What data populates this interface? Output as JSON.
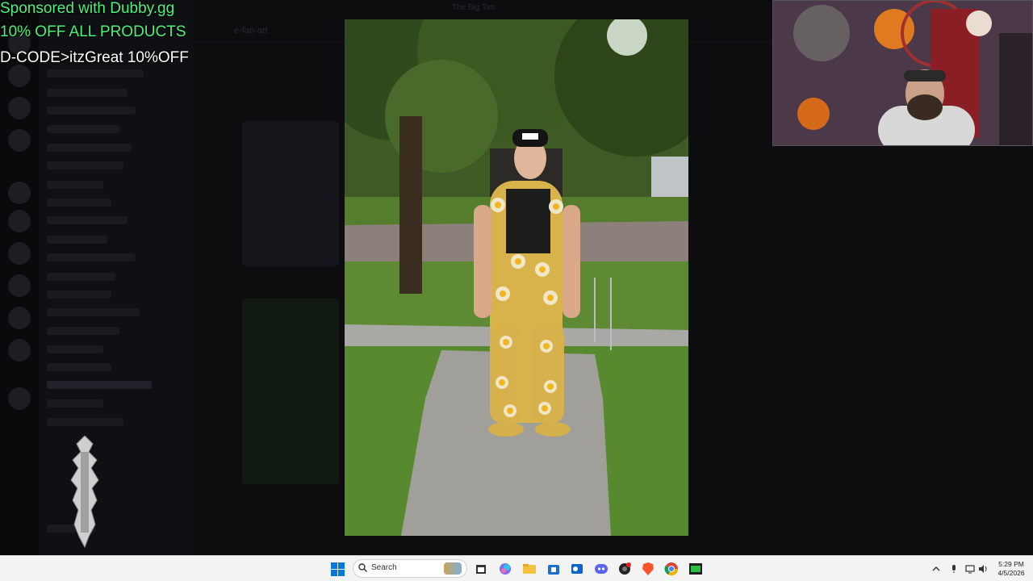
{
  "sponsor": {
    "line1": "Sponsored with Dubby.gg",
    "line2": "10% OFF ALL PRODUCTS",
    "line3": "D-CODE>itzGreat 10%OFF"
  },
  "background_app": {
    "window_title": "The Big Tim",
    "channel_name": "e-fan-art"
  },
  "taskbar": {
    "search_placeholder": "Search",
    "time": "5:29 PM",
    "date": "4/5/2026",
    "pinned_apps": [
      "file-explorer",
      "copilot",
      "folder",
      "store",
      "outlook",
      "discord",
      "obs",
      "brave",
      "chrome",
      "terminal"
    ]
  },
  "colors": {
    "sponsor_green": "#4cf27a",
    "taskbar_bg": "#f3f3f3",
    "windows_blue": "#0078d4"
  }
}
